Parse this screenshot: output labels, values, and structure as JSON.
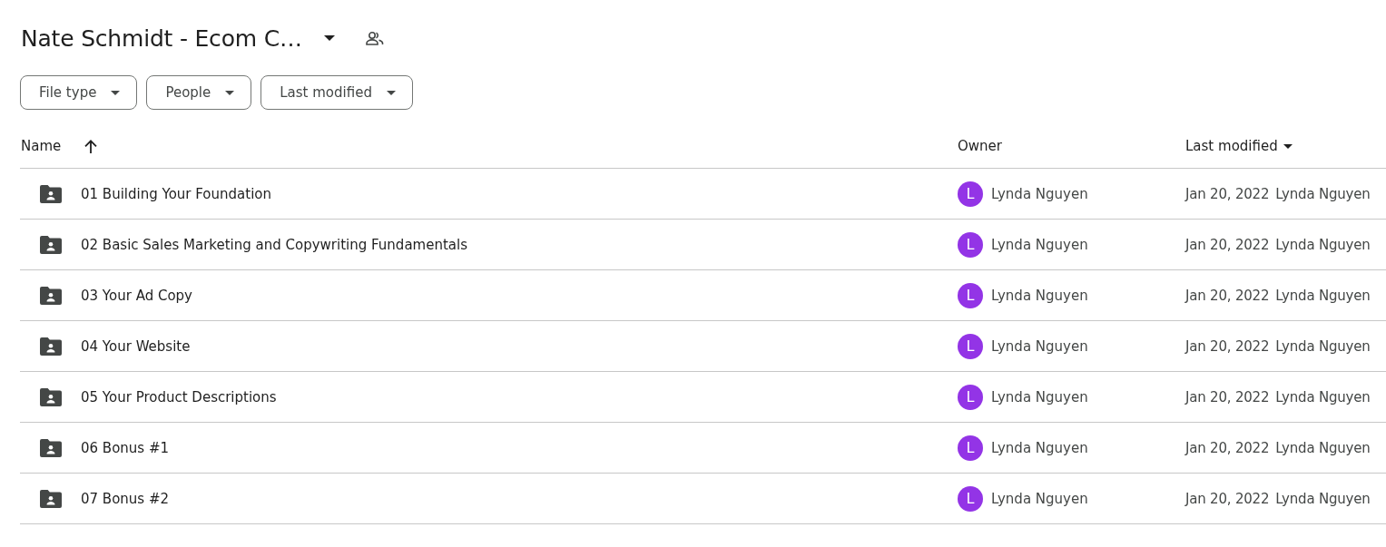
{
  "header": {
    "title": "Nate Schmidt - Ecom C…",
    "title_menu": true,
    "shared": true
  },
  "filters": [
    {
      "label": "File type"
    },
    {
      "label": "People"
    },
    {
      "label": "Last modified"
    }
  ],
  "table": {
    "columns": [
      {
        "label": "Name",
        "sorted": true,
        "dropdown": false
      },
      {
        "label": "Owner",
        "sorted": false,
        "dropdown": false
      },
      {
        "label": "Last modified",
        "sorted": false,
        "dropdown": true
      }
    ],
    "rows": [
      {
        "name": "01 Building Your Foundation",
        "owner": {
          "initial": "L",
          "name": "Lynda Nguyen"
        },
        "modified": "Jan 20, 2022",
        "modified_by": "Lynda Nguyen"
      },
      {
        "name": "02 Basic Sales Marketing and Copywriting Fundamentals",
        "owner": {
          "initial": "L",
          "name": "Lynda Nguyen"
        },
        "modified": "Jan 20, 2022",
        "modified_by": "Lynda Nguyen"
      },
      {
        "name": "03 Your Ad Copy",
        "owner": {
          "initial": "L",
          "name": "Lynda Nguyen"
        },
        "modified": "Jan 20, 2022",
        "modified_by": "Lynda Nguyen"
      },
      {
        "name": "04 Your Website",
        "owner": {
          "initial": "L",
          "name": "Lynda Nguyen"
        },
        "modified": "Jan 20, 2022",
        "modified_by": "Lynda Nguyen"
      },
      {
        "name": "05 Your Product Descriptions",
        "owner": {
          "initial": "L",
          "name": "Lynda Nguyen"
        },
        "modified": "Jan 20, 2022",
        "modified_by": "Lynda Nguyen"
      },
      {
        "name": "06 Bonus #1",
        "owner": {
          "initial": "L",
          "name": "Lynda Nguyen"
        },
        "modified": "Jan 20, 2022",
        "modified_by": "Lynda Nguyen"
      },
      {
        "name": "07 Bonus #2",
        "owner": {
          "initial": "L",
          "name": "Lynda Nguyen"
        },
        "modified": "Jan 20, 2022",
        "modified_by": "Lynda Nguyen"
      }
    ]
  }
}
